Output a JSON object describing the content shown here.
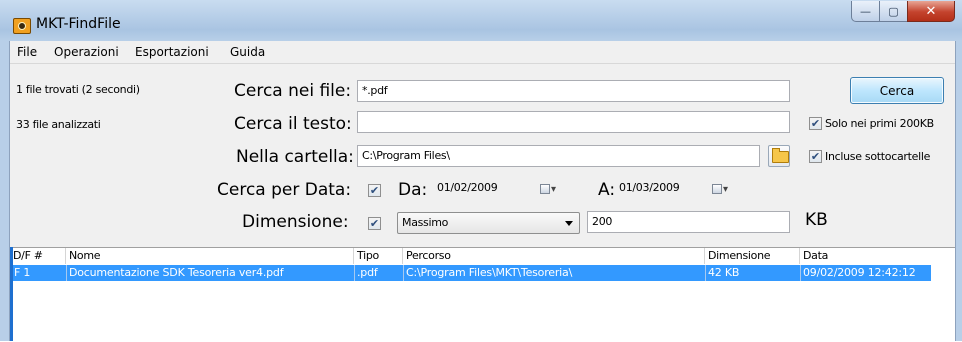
{
  "window": {
    "title": "MKT-FindFile",
    "minimize_glyph": "—",
    "maximize_glyph": "▢",
    "close_glyph": "✕",
    "app_icon": "camera-icon"
  },
  "menu": [
    "File",
    "Operazioni",
    "Esportazioni",
    "Guida"
  ],
  "status": {
    "found": "1 file trovati (2 secondi)",
    "analyzed": "33 file analizzati"
  },
  "form": {
    "search_files_label": "Cerca nei file:",
    "search_files_value": "*.pdf",
    "search_button": "Cerca",
    "search_text_label": "Cerca il testo:",
    "search_text_value": "",
    "only_first_label": "Solo nei primi 200KB",
    "only_first_checked": true,
    "folder_label": "Nella cartella:",
    "folder_value": "C:\\Program Files\\",
    "include_sub_label": "Incluse sottocartelle",
    "include_sub_checked": true,
    "date_label": "Cerca per Data:",
    "date_checked": true,
    "from_label": "Da:",
    "from_value": "01/02/2009",
    "to_label": "A:",
    "to_value": "01/03/2009",
    "size_label": "Dimensione:",
    "size_checked": true,
    "size_mode": "Massimo",
    "size_value": "200",
    "size_unit": "KB"
  },
  "results": {
    "columns": [
      "D/F #",
      "Nome",
      "Tipo",
      "Percorso",
      "Dimensione",
      "Data"
    ],
    "rows": [
      {
        "df": "F  1",
        "nome": "Documentazione SDK Tesoreria ver4.pdf",
        "tipo": ".pdf",
        "percorso": "C:\\Program Files\\MKT\\Tesoreria\\",
        "dimensione": "42 KB",
        "data": "09/02/2009 12:42:12"
      }
    ]
  },
  "colors": {
    "selection": "#3399ff",
    "window_chrome": "#b8cfe8",
    "client_bg": "#f0f0f0"
  }
}
